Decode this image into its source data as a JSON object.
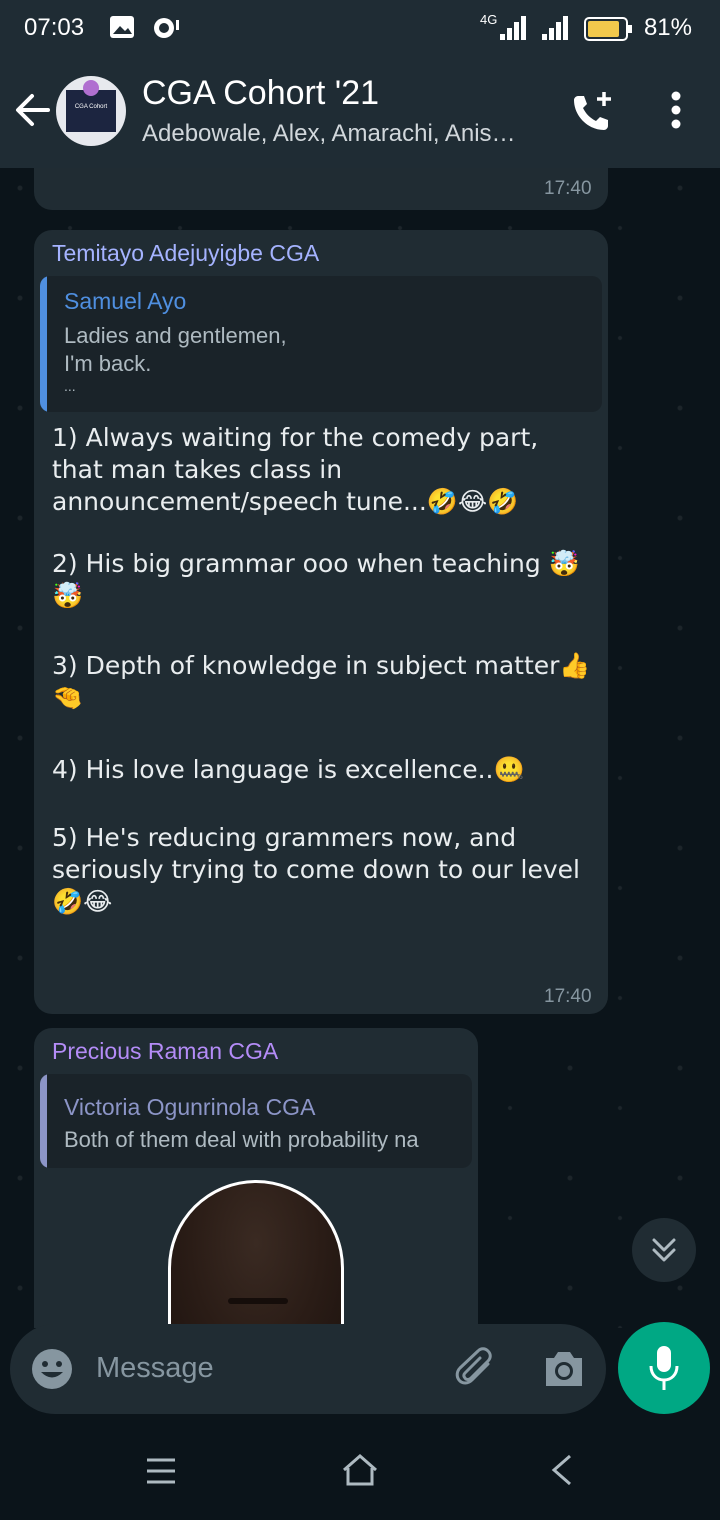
{
  "status": {
    "time": "07:03",
    "network": "4G",
    "battery": "81%"
  },
  "header": {
    "title": "CGA Cohort '21",
    "subtitle": "Adebowale, Alex, Amarachi, Anis…",
    "avatar_text": "CGA Cohort"
  },
  "messages": [
    {
      "time": "17:40"
    },
    {
      "sender": "Temitayo Adejuyigbe CGA",
      "quote_name": "Samuel Ayo",
      "quote_lines": [
        "Ladies and gentlemen,",
        "I'm back.",
        "..."
      ],
      "lines": [
        "1) Always waiting for the comedy part, that man takes class in announcement/speech tune...🤣😂🤣",
        "2) His big grammar ooo when teaching 🤯🤯",
        "3) Depth of knowledge in subject matter👍🤏",
        "4) His love language is excellence..🤐",
        "5) He's reducing grammers now, and seriously trying to come down to our level 🤣😂"
      ],
      "time": "17:40"
    },
    {
      "sender": "Precious Raman CGA",
      "quote_name": "Victoria Ogunrinola CGA",
      "quote_text": "Both of them deal with probability na"
    }
  ],
  "input": {
    "placeholder": "Message"
  },
  "colors": {
    "accent": "#00a884",
    "sender1": "#a5b3ff",
    "sender2": "#b48cf7",
    "quote1_bar": "#4f8fe0",
    "quote2_bar": "#8c95c7"
  }
}
